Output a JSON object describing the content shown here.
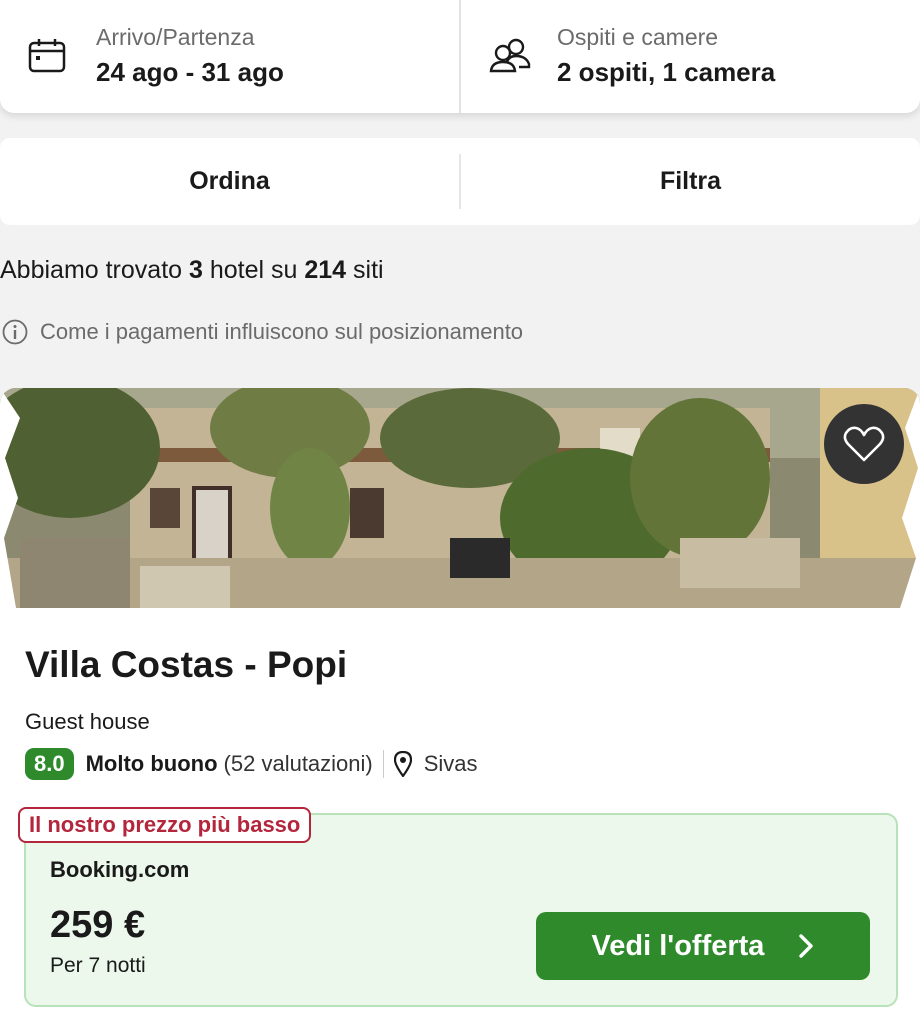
{
  "search": {
    "dates_label": "Arrivo/Partenza",
    "dates_value": "24 ago - 31 ago",
    "guests_label": "Ospiti e camere",
    "guests_value": "2 ospiti, 1 camera"
  },
  "toolbar": {
    "sort_label": "Ordina",
    "filter_label": "Filtra"
  },
  "results": {
    "prefix": "Abbiamo trovato",
    "hotel_count": "3",
    "middle": "hotel su",
    "site_count": "214",
    "suffix": "siti"
  },
  "ranking_info": "Come i pagamenti influiscono sul posizionamento",
  "hotel": {
    "name": "Villa Costas - Popi",
    "type": "Guest house",
    "score": "8.0",
    "rating_label": "Molto buono",
    "reviews": "(52 valutazioni)",
    "location": "Sivas",
    "badge": "Il nostro prezzo più basso",
    "provider": "Booking.com",
    "price": "259 €",
    "price_note": "Per 7 notti",
    "cta_label": "Vedi l'offerta"
  },
  "icons": {
    "calendar": "calendar-icon",
    "guests": "users-icon",
    "info": "info-icon",
    "favorite": "heart-icon",
    "location": "map-pin-icon",
    "chevron": "chevron-right-icon"
  },
  "colors": {
    "accent_green": "#2f8a2c",
    "badge_red": "#b3263c",
    "offer_bg": "#ecf8ec"
  }
}
